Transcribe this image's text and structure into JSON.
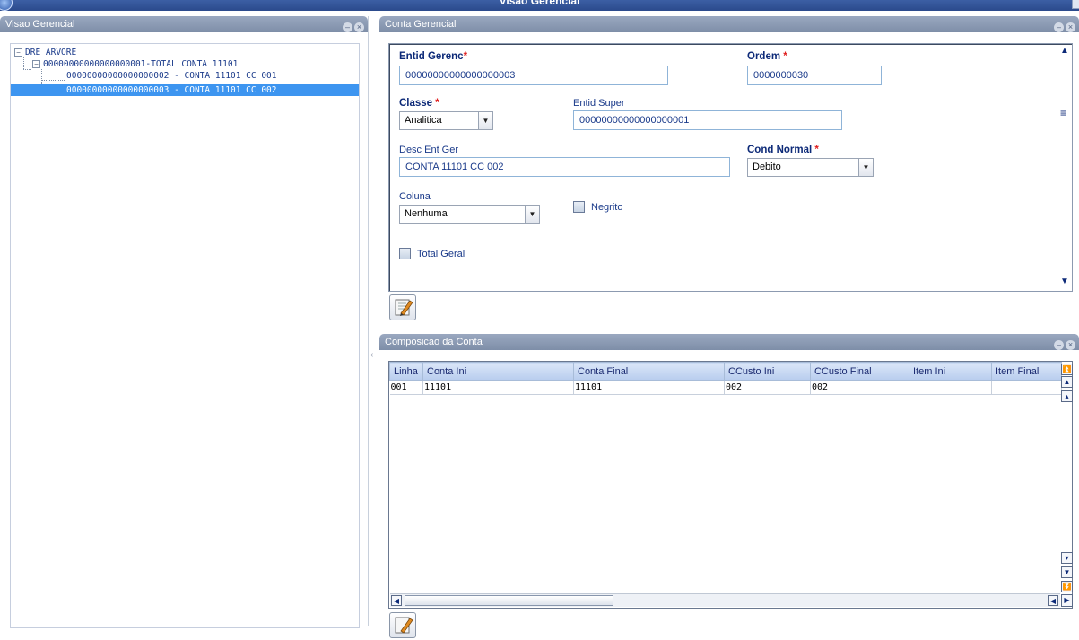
{
  "window": {
    "title": "Visao Gerencial"
  },
  "left_panel": {
    "title": "Visao Gerencial",
    "tree": [
      {
        "label": "DRE ARVORE",
        "level": 0,
        "expanded": true,
        "selected": false
      },
      {
        "label": "00000000000000000001-TOTAL CONTA 11101",
        "level": 1,
        "expanded": true,
        "selected": false
      },
      {
        "label": "00000000000000000002 - CONTA 11101 CC 001",
        "level": 2,
        "expanded": false,
        "selected": false
      },
      {
        "label": "00000000000000000003 - CONTA 11101 CC 002",
        "level": 2,
        "expanded": false,
        "selected": true
      }
    ]
  },
  "form_panel": {
    "title": "Conta Gerencial",
    "fields": {
      "entid_gerenc": {
        "label": "Entid Gerenc",
        "value": "00000000000000000003",
        "required": true
      },
      "ordem": {
        "label": "Ordem",
        "value": "0000000030",
        "required": true
      },
      "classe": {
        "label": "Classe",
        "value": "Analitica",
        "required": true
      },
      "entid_super": {
        "label": "Entid Super",
        "value": "00000000000000000001",
        "required": false
      },
      "desc_ent_ger": {
        "label": "Desc Ent Ger",
        "value": "CONTA 11101 CC 002",
        "required": false
      },
      "cond_normal": {
        "label": "Cond Normal",
        "value": "Debito",
        "required": true
      },
      "coluna": {
        "label": "Coluna",
        "value": "Nenhuma",
        "required": false
      },
      "negrito": {
        "label": "Negrito",
        "checked": false
      },
      "total_geral": {
        "label": "Total Geral",
        "checked": false
      }
    },
    "required_mark": "*"
  },
  "comp_panel": {
    "title": "Composicao da Conta",
    "columns": [
      "Linha",
      "Conta Ini",
      "Conta Final",
      "CCusto Ini",
      "CCusto Final",
      "Item Ini",
      "Item Final"
    ],
    "rows": [
      [
        "001",
        "11101",
        "11101",
        "002",
        "002",
        "",
        ""
      ]
    ]
  },
  "colors": {
    "panel_header": "#8a98b0",
    "selection": "#3d95f0",
    "label_text": "#1a3a8a",
    "required_star": "#e02020"
  }
}
